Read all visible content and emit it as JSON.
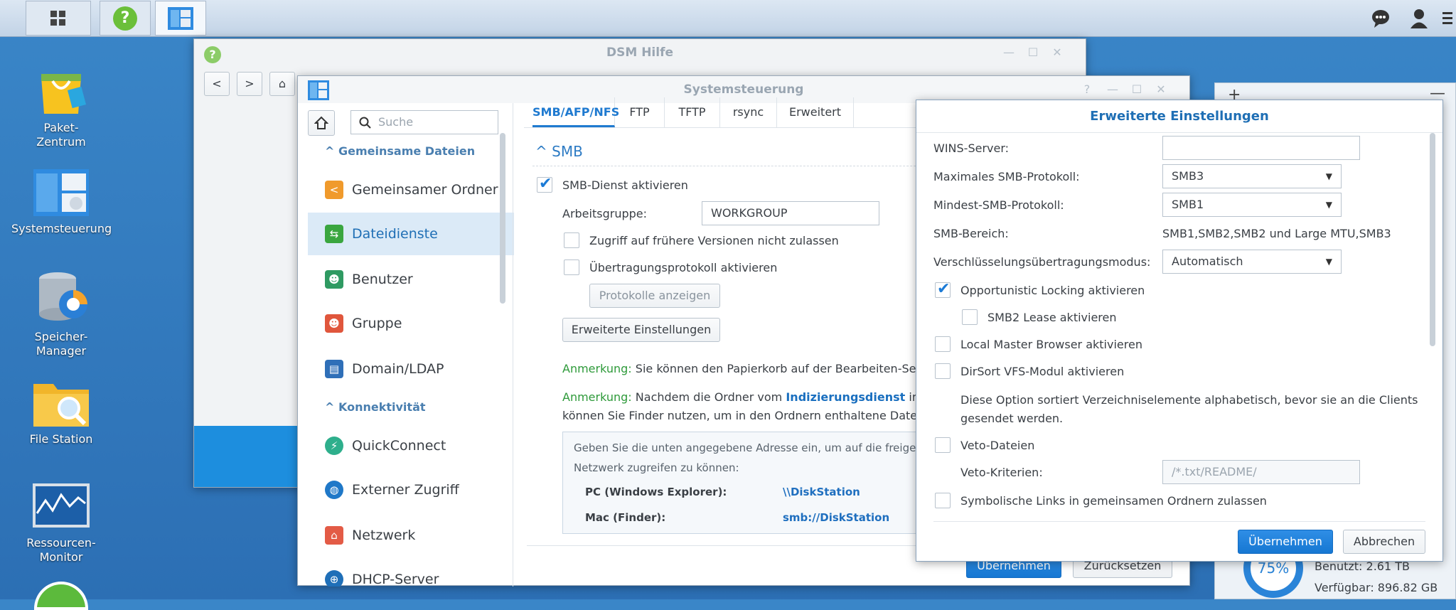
{
  "taskbar": {
    "main_menu": "main-menu",
    "help": "?"
  },
  "desktop": {
    "icons": [
      {
        "label": "Paket-\nZentrum"
      },
      {
        "label": "Systemsteuerung"
      },
      {
        "label": "Speicher-\nManager"
      },
      {
        "label": "File Station"
      },
      {
        "label": "Ressourcen-\nMonitor"
      }
    ]
  },
  "help_window": {
    "title": "DSM Hilfe"
  },
  "control_panel": {
    "title": "Systemsteuerung",
    "search_placeholder": "Suche",
    "sections": [
      {
        "label": "Gemeinsame Dateien"
      },
      {
        "label": "Konnektivität"
      }
    ],
    "nav": [
      {
        "label": "Gemeinsamer Ordner"
      },
      {
        "label": "Dateidienste"
      },
      {
        "label": "Benutzer"
      },
      {
        "label": "Gruppe"
      },
      {
        "label": "Domain/LDAP"
      },
      {
        "label": "QuickConnect"
      },
      {
        "label": "Externer Zugriff"
      },
      {
        "label": "Netzwerk"
      },
      {
        "label": "DHCP-Server"
      }
    ],
    "tabs": [
      {
        "label": "SMB/AFP/NFS"
      },
      {
        "label": "FTP"
      },
      {
        "label": "TFTP"
      },
      {
        "label": "rsync"
      },
      {
        "label": "Erweitert"
      }
    ],
    "smb": {
      "heading": "SMB",
      "enable_label": "SMB-Dienst aktivieren",
      "workgroup_label": "Arbeitsgruppe:",
      "workgroup_value": "WORKGROUP",
      "prev_versions_label": "Zugriff auf frühere Versionen nicht zulassen",
      "transfer_log_label": "Übertragungsprotokoll aktivieren",
      "show_logs_button": "Protokolle anzeigen",
      "advanced_button": "Erweiterte Einstellungen",
      "note1_prefix": "Anmerkung:",
      "note1_text": "Sie können den Papierkorb auf der Bearbeiten-Seite",
      "note2_prefix": "Anmerkung:",
      "note2_text": "Nachdem die Ordner vom",
      "note2_link": "Indizierungsdienst",
      "note2_tail": "indiz",
      "note2_line2": "können Sie Finder nutzen, um in den Ordnern enthaltene Dateien",
      "info_line1": "Geben Sie die unten angegebene Adresse ein, um auf die freigegebe",
      "info_line2": "Netzwerk zugreifen zu können:",
      "pc_label": "PC (Windows Explorer):",
      "pc_value": "\\\\DiskStation",
      "mac_label": "Mac (Finder):",
      "mac_value": "smb://DiskStation"
    },
    "apply_button": "Übernehmen",
    "reset_button": "Zurücksetzen"
  },
  "dialog": {
    "title": "Erweiterte Einstellungen",
    "wins_label": "WINS-Server:",
    "wins_value": "",
    "max_proto_label": "Maximales SMB-Protokoll:",
    "max_proto_value": "SMB3",
    "min_proto_label": "Mindest-SMB-Protokoll:",
    "min_proto_value": "SMB1",
    "range_label": "SMB-Bereich:",
    "range_value": "SMB1,SMB2,SMB2 und Large MTU,SMB3",
    "enc_label": "Verschlüsselungsübertragungsmodus:",
    "enc_value": "Automatisch",
    "oplock_label": "Opportunistic Locking aktivieren",
    "smb2lease_label": "SMB2 Lease aktivieren",
    "lmb_label": "Local Master Browser aktivieren",
    "dirsort_label": "DirSort VFS-Modul aktivieren",
    "dirsort_desc1": "Diese Option sortiert Verzeichniselemente alphabetisch, bevor sie an die Clients",
    "dirsort_desc2": "gesendet werden.",
    "veto_label": "Veto-Dateien",
    "veto_criteria_label": "Veto-Kriterien:",
    "veto_placeholder": "/*.txt/README/",
    "symlink_label": "Symbolische Links in gemeinsamen Ordnern zulassen",
    "apply_button": "Übernehmen",
    "cancel_button": "Abbrechen"
  },
  "storage_widget": {
    "percent": "75%",
    "used": "Benutzt: 2.61 TB",
    "free": "Verfügbar: 896.82 GB"
  }
}
